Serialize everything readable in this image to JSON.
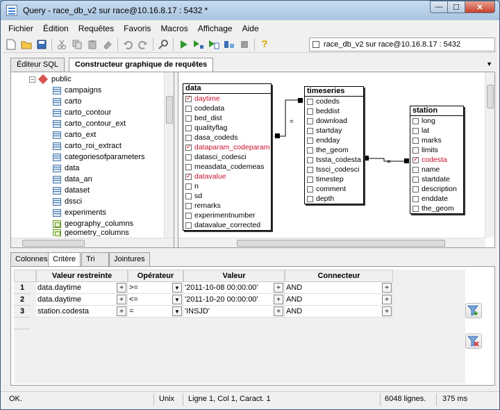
{
  "window": {
    "title": "Query - race_db_v2 sur race@10.16.8.17 : 5432 *",
    "buttons": {
      "minimize": "—",
      "maximize": "☐",
      "close": "✕"
    }
  },
  "menu": [
    "Fichier",
    "Édition",
    "Requêtes",
    "Favoris",
    "Macros",
    "Affichage",
    "Aide"
  ],
  "toolbar": {
    "icons": [
      "new-file-icon",
      "open-folder-icon",
      "save-icon",
      "cut-icon",
      "copy-icon",
      "paste-icon",
      "eraser-icon",
      "undo-icon",
      "redo-icon",
      "find-icon",
      "execute-icon",
      "explain-icon",
      "execute-to-file-icon",
      "explain-analyze-icon",
      "stop-icon",
      "help-icon"
    ],
    "connection": "race_db_v2 sur race@10.16.8.17 : 5432"
  },
  "tabs": [
    "Éditeur SQL",
    "Constructeur graphique de requêtes"
  ],
  "tree": {
    "schema": "public",
    "items": [
      {
        "label": "campaigns",
        "kind": "table"
      },
      {
        "label": "carto",
        "kind": "table"
      },
      {
        "label": "carto_contour",
        "kind": "table"
      },
      {
        "label": "carto_contour_ext",
        "kind": "table"
      },
      {
        "label": "carto_ext",
        "kind": "table"
      },
      {
        "label": "carto_roi_extract",
        "kind": "table"
      },
      {
        "label": "categoriesofparameters",
        "kind": "table"
      },
      {
        "label": "data",
        "kind": "table"
      },
      {
        "label": "data_an",
        "kind": "table"
      },
      {
        "label": "dataset",
        "kind": "table"
      },
      {
        "label": "dssci",
        "kind": "table"
      },
      {
        "label": "experiments",
        "kind": "table"
      },
      {
        "label": "geography_columns",
        "kind": "view"
      },
      {
        "label": "geometry_columns",
        "kind": "view"
      }
    ]
  },
  "tables": {
    "data": {
      "title": "data",
      "fields": [
        {
          "name": "daytime",
          "checked": true
        },
        {
          "name": "codedata",
          "checked": false
        },
        {
          "name": "bed_dist",
          "checked": false
        },
        {
          "name": "qualityflag",
          "checked": false
        },
        {
          "name": "dasa_codeds",
          "checked": false
        },
        {
          "name": "dataparam_codeparam",
          "checked": true
        },
        {
          "name": "datasci_codesci",
          "checked": false
        },
        {
          "name": "measdata_codemeas",
          "checked": false
        },
        {
          "name": "datavalue",
          "checked": true
        },
        {
          "name": "n",
          "checked": false
        },
        {
          "name": "sd",
          "checked": false
        },
        {
          "name": "remarks",
          "checked": false
        },
        {
          "name": "experimentnumber",
          "checked": false
        },
        {
          "name": "datavalue_corrected",
          "checked": false
        }
      ]
    },
    "timeseries": {
      "title": "timeseries",
      "fields": [
        {
          "name": "codeds",
          "checked": false
        },
        {
          "name": "beddist",
          "checked": false
        },
        {
          "name": "download",
          "checked": false
        },
        {
          "name": "startday",
          "checked": false
        },
        {
          "name": "endday",
          "checked": false
        },
        {
          "name": "the_geom",
          "checked": false
        },
        {
          "name": "tssta_codesta",
          "checked": false
        },
        {
          "name": "tssci_codesci",
          "checked": false
        },
        {
          "name": "timestep",
          "checked": false
        },
        {
          "name": "comment",
          "checked": false
        },
        {
          "name": "depth",
          "checked": false
        }
      ]
    },
    "station": {
      "title": "station",
      "fields": [
        {
          "name": "long",
          "checked": false
        },
        {
          "name": "lat",
          "checked": false
        },
        {
          "name": "marks",
          "checked": false
        },
        {
          "name": "limits",
          "checked": false
        },
        {
          "name": "codesta",
          "checked": true
        },
        {
          "name": "name",
          "checked": false
        },
        {
          "name": "startdate",
          "checked": false
        },
        {
          "name": "description",
          "checked": false
        },
        {
          "name": "enddate",
          "checked": false
        },
        {
          "name": "the_geom",
          "checked": false
        }
      ]
    },
    "join_symbols": [
      "=",
      "="
    ]
  },
  "criteria_tabs": [
    "Colonnes",
    "Critère",
    "Tri",
    "Jointures"
  ],
  "criteria": {
    "headers": [
      "Valeur restreinte",
      "Opérateur",
      "Valeur",
      "Connecteur"
    ],
    "rows": [
      {
        "num": "1",
        "column": "data.daytime",
        "operator": ">=",
        "value": "'2011-10-08 00:00:00'",
        "connector": "AND"
      },
      {
        "num": "2",
        "column": "data.daytime",
        "operator": "<=",
        "value": "'2011-10-20 00:00:00'",
        "connector": "AND"
      },
      {
        "num": "3",
        "column": "station.codesta",
        "operator": "=",
        "value": "'INSJD'",
        "connector": "AND"
      }
    ]
  },
  "status": {
    "message": "OK.",
    "line_ending": "Unix",
    "position": "Ligne 1, Col 1, Caract. 1",
    "rows": "6048 lignes.",
    "time": "375 ms"
  }
}
